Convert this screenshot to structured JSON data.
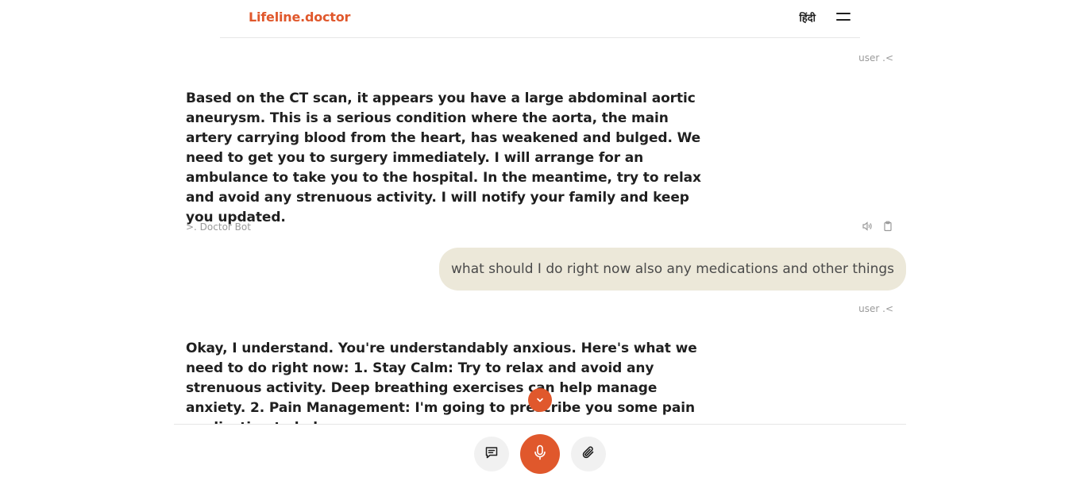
{
  "header": {
    "logo": "Lifeline.doctor",
    "language": "हिंदी"
  },
  "chat": {
    "messages": [
      {
        "role": "user-meta",
        "label": "user .<"
      },
      {
        "role": "bot",
        "text": "Based on the CT scan, it appears you have a large abdominal aortic aneurysm. This is a serious condition where the aorta, the main artery carrying blood from the heart, has weakened and bulged. We need to get you to surgery immediately. I will arrange for an ambulance to take you to the hospital. In the meantime, try to relax and avoid any strenuous activity. I will notify your family and keep you updated.",
        "sender": ">. Doctor Bot"
      },
      {
        "role": "user",
        "text": "what should I do right now also any medications and other things",
        "sender": "user .<"
      },
      {
        "role": "bot",
        "text": "Okay, I understand. You're understandably anxious. Here's what we need to do right now: 1. Stay Calm: Try to relax and avoid any strenuous activity. Deep breathing exercises can help manage anxiety. 2. Pain Management: I'm going to prescribe you some pain medication to help"
      }
    ]
  },
  "icons": {
    "speaker": "speaker-icon",
    "copy": "clipboard-icon",
    "scroll_down": "chevron-down-icon",
    "chat": "message-icon",
    "mic": "microphone-icon",
    "attach": "paperclip-icon"
  },
  "colors": {
    "accent": "#e0582c",
    "user_bubble": "#ece8d9",
    "muted_text": "#9a9a9a"
  }
}
